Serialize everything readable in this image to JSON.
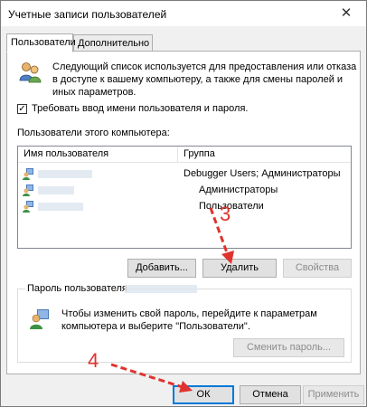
{
  "window": {
    "title": "Учетные записи пользователей",
    "close_glyph": "✕"
  },
  "tabs": [
    {
      "label": "Пользователи"
    },
    {
      "label": "Дополнительно"
    }
  ],
  "intro": {
    "text_line1": "Следующий список используется для предоставления или отказа",
    "text_line2": "в доступе к вашему компьютеру, а также для смены паролей и",
    "text_line3": "иных параметров."
  },
  "require_password": {
    "label": "Требовать ввод имени пользователя и пароля.",
    "checked": true
  },
  "users_section_label": "Пользователи этого компьютера:",
  "list": {
    "columns": [
      "Имя пользователя",
      "Группа"
    ],
    "rows": [
      {
        "group": "Debugger Users; Администраторы"
      },
      {
        "group": "Администраторы"
      },
      {
        "group": "Пользователи"
      }
    ]
  },
  "buttons": {
    "add": "Добавить...",
    "remove": "Удалить",
    "properties": "Свойства",
    "change_password": "Сменить пароль...",
    "ok": "ОК",
    "cancel": "Отмена",
    "apply": "Применить"
  },
  "password_group": {
    "label": "Пароль пользователя",
    "text_line1": "Чтобы изменить свой пароль, перейдите к параметрам",
    "text_line2": "компьютера и выберите \"Пользователи\"."
  },
  "annotations": [
    {
      "number": "3"
    },
    {
      "number": "4"
    }
  ],
  "colors": {
    "annotation": "#e0332e",
    "accent": "#0078d7"
  }
}
